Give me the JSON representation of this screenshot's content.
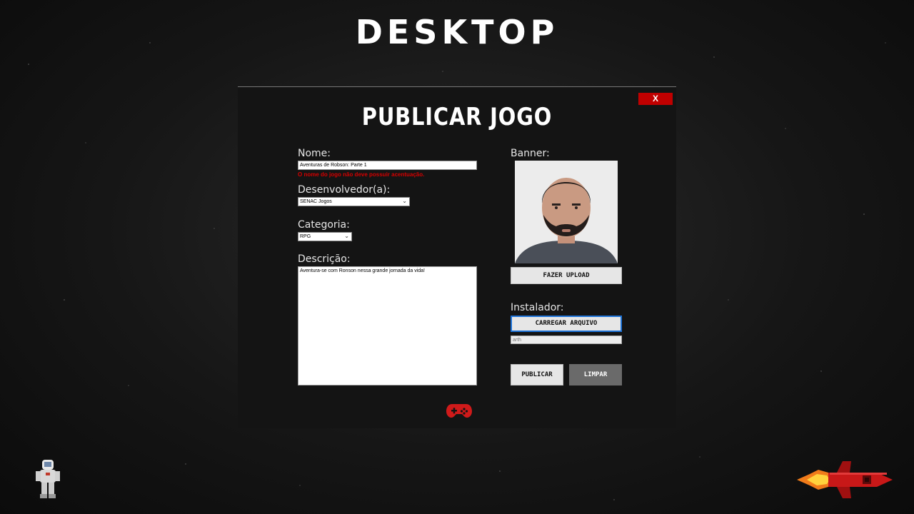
{
  "slide": {
    "title": "DESKTOP"
  },
  "dialog": {
    "title": "PUBLICAR JOGO",
    "close_label": "X",
    "name": {
      "label": "Nome:",
      "value": "Aventuras de Robson: Parte 1",
      "error": "O nome do jogo não deve possuir acentuação."
    },
    "developer": {
      "label": "Desenvolvedor(a):",
      "selected": "SENAC Jogos"
    },
    "category": {
      "label": "Categoria:",
      "selected": "RPG"
    },
    "description": {
      "label": "Descrição:",
      "value": "Aventura-se com Ronson nessa grande jornada da vida!"
    },
    "banner": {
      "label": "Banner:",
      "upload_button": "FAZER UPLOAD"
    },
    "installer": {
      "label": "Instalador:",
      "load_button": "CARREGAR ARQUIVO",
      "file_value": "arth"
    },
    "publish_button": "PUBLICAR",
    "clear_button": "LIMPAR"
  },
  "colors": {
    "accent": "#c00000",
    "window_bg": "#141414",
    "error": "#d60000",
    "focus": "#1e73d8"
  },
  "icons": [
    "close-icon",
    "gamepad-icon",
    "astronaut-icon",
    "rocket-icon",
    "chevron-down-icon"
  ]
}
